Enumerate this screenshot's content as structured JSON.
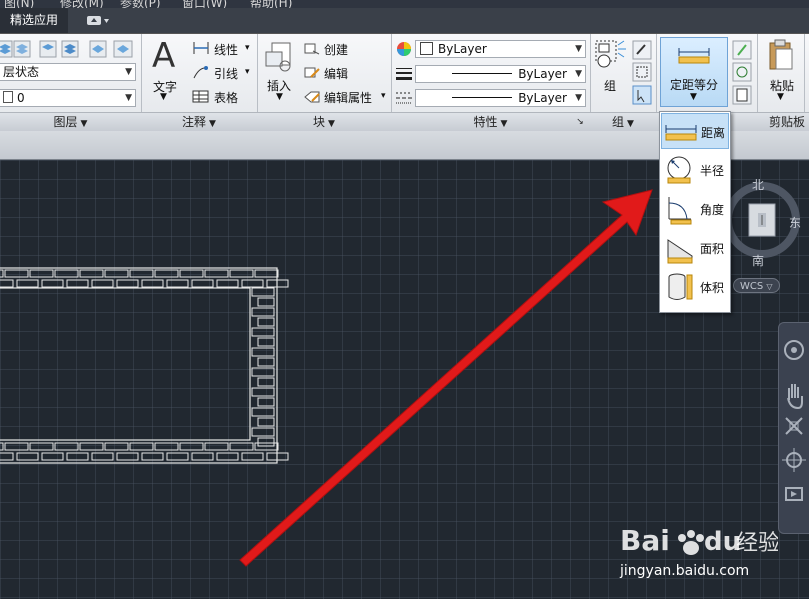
{
  "menubar": {
    "items": [
      "图(N)",
      "修改(M)",
      "参数(P)",
      "窗口(W)",
      "帮助(H)"
    ]
  },
  "tabs": {
    "active": "精选应用"
  },
  "ribbon": {
    "layers": {
      "state_value": "层状态",
      "layer_value": "0",
      "panel_title": "图层"
    },
    "annotation": {
      "text_label": "文字",
      "linear_label": "线性",
      "leader_label": "引线",
      "table_label": "表格",
      "panel_title": "注释"
    },
    "block": {
      "insert_label": "插入",
      "create_label": "创建",
      "edit_label": "编辑",
      "edit_attr_label": "编辑属性",
      "panel_title": "块"
    },
    "properties": {
      "color_value": "ByLayer",
      "linetype_value": "ByLayer",
      "lineweight_value": "ByLayer",
      "panel_title": "特性"
    },
    "groups": {
      "group_label": "组",
      "panel_title": "组"
    },
    "utilities": {
      "measure_label": "定距等分"
    },
    "clipboard": {
      "paste_label": "粘贴",
      "panel_title": "剪贴板"
    }
  },
  "measure_menu": {
    "items": [
      {
        "label": "距离",
        "icon": "distance-icon"
      },
      {
        "label": "半径",
        "icon": "radius-icon"
      },
      {
        "label": "角度",
        "icon": "angle-icon"
      },
      {
        "label": "面积",
        "icon": "area-icon"
      },
      {
        "label": "体积",
        "icon": "volume-icon"
      }
    ],
    "selected": "距离"
  },
  "viewcube": {
    "north": "北",
    "south": "南",
    "east": "东",
    "wcs": "WCS"
  },
  "watermark": {
    "logo": "Baidu经验",
    "url": "jingyan.baidu.com"
  },
  "colors": {
    "canvas": "#212830",
    "arrow": "#e11a1a",
    "highlight": "#c7e1f7"
  }
}
